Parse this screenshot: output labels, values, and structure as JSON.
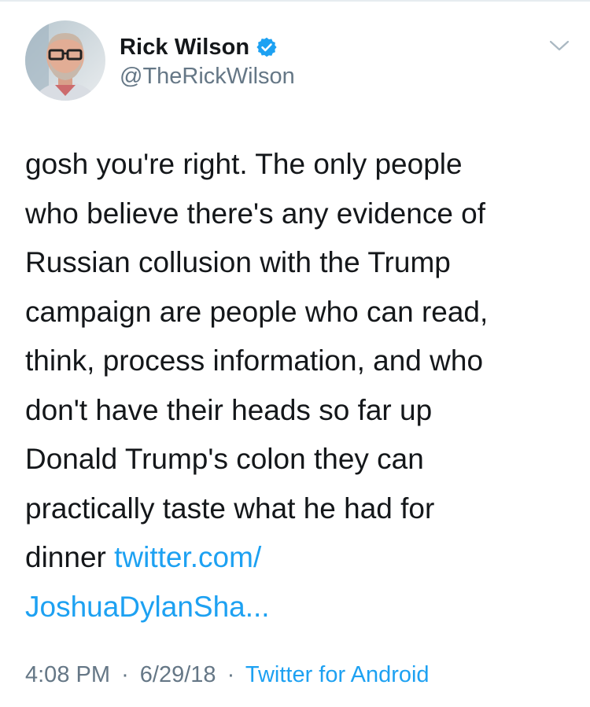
{
  "author": {
    "display_name": "Rick Wilson",
    "handle": "@TheRickWilson",
    "verified": true,
    "avatar_icon": "profile-photo"
  },
  "tweet": {
    "text_lines": [
      "gosh you're right. The only people",
      "who believe there's any evidence of",
      "Russian collusion with the Trump",
      "campaign are people who can read,",
      "think, process information, and who",
      "don't have their heads so far up",
      "Donald Trump's colon they can",
      "practically taste what he had for"
    ],
    "last_line_prefix": "dinner ",
    "link_part1": "twitter.com/",
    "link_part2": "JoshuaDylanSha..."
  },
  "meta": {
    "time": "4:08 PM",
    "separator": "·",
    "date": "6/29/18",
    "source": "Twitter for Android"
  },
  "colors": {
    "link": "#1da1f2",
    "secondary_text": "#657786",
    "primary_text": "#14171a"
  },
  "icons": {
    "verified": "verified-badge-icon",
    "more": "chevron-down-icon"
  }
}
